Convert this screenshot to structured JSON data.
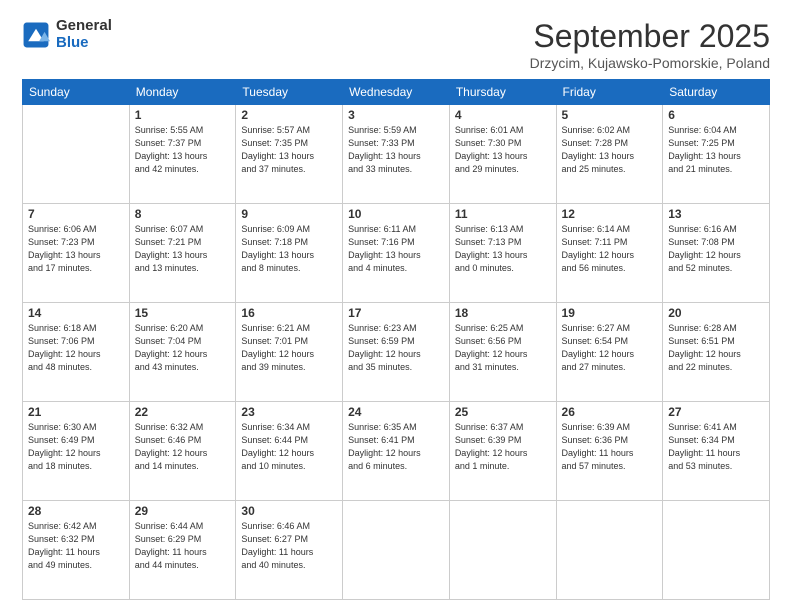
{
  "logo": {
    "general": "General",
    "blue": "Blue"
  },
  "header": {
    "month": "September 2025",
    "location": "Drzycim, Kujawsko-Pomorskie, Poland"
  },
  "weekdays": [
    "Sunday",
    "Monday",
    "Tuesday",
    "Wednesday",
    "Thursday",
    "Friday",
    "Saturday"
  ],
  "weeks": [
    [
      {
        "day": "",
        "info": ""
      },
      {
        "day": "1",
        "info": "Sunrise: 5:55 AM\nSunset: 7:37 PM\nDaylight: 13 hours\nand 42 minutes."
      },
      {
        "day": "2",
        "info": "Sunrise: 5:57 AM\nSunset: 7:35 PM\nDaylight: 13 hours\nand 37 minutes."
      },
      {
        "day": "3",
        "info": "Sunrise: 5:59 AM\nSunset: 7:33 PM\nDaylight: 13 hours\nand 33 minutes."
      },
      {
        "day": "4",
        "info": "Sunrise: 6:01 AM\nSunset: 7:30 PM\nDaylight: 13 hours\nand 29 minutes."
      },
      {
        "day": "5",
        "info": "Sunrise: 6:02 AM\nSunset: 7:28 PM\nDaylight: 13 hours\nand 25 minutes."
      },
      {
        "day": "6",
        "info": "Sunrise: 6:04 AM\nSunset: 7:25 PM\nDaylight: 13 hours\nand 21 minutes."
      }
    ],
    [
      {
        "day": "7",
        "info": "Sunrise: 6:06 AM\nSunset: 7:23 PM\nDaylight: 13 hours\nand 17 minutes."
      },
      {
        "day": "8",
        "info": "Sunrise: 6:07 AM\nSunset: 7:21 PM\nDaylight: 13 hours\nand 13 minutes."
      },
      {
        "day": "9",
        "info": "Sunrise: 6:09 AM\nSunset: 7:18 PM\nDaylight: 13 hours\nand 8 minutes."
      },
      {
        "day": "10",
        "info": "Sunrise: 6:11 AM\nSunset: 7:16 PM\nDaylight: 13 hours\nand 4 minutes."
      },
      {
        "day": "11",
        "info": "Sunrise: 6:13 AM\nSunset: 7:13 PM\nDaylight: 13 hours\nand 0 minutes."
      },
      {
        "day": "12",
        "info": "Sunrise: 6:14 AM\nSunset: 7:11 PM\nDaylight: 12 hours\nand 56 minutes."
      },
      {
        "day": "13",
        "info": "Sunrise: 6:16 AM\nSunset: 7:08 PM\nDaylight: 12 hours\nand 52 minutes."
      }
    ],
    [
      {
        "day": "14",
        "info": "Sunrise: 6:18 AM\nSunset: 7:06 PM\nDaylight: 12 hours\nand 48 minutes."
      },
      {
        "day": "15",
        "info": "Sunrise: 6:20 AM\nSunset: 7:04 PM\nDaylight: 12 hours\nand 43 minutes."
      },
      {
        "day": "16",
        "info": "Sunrise: 6:21 AM\nSunset: 7:01 PM\nDaylight: 12 hours\nand 39 minutes."
      },
      {
        "day": "17",
        "info": "Sunrise: 6:23 AM\nSunset: 6:59 PM\nDaylight: 12 hours\nand 35 minutes."
      },
      {
        "day": "18",
        "info": "Sunrise: 6:25 AM\nSunset: 6:56 PM\nDaylight: 12 hours\nand 31 minutes."
      },
      {
        "day": "19",
        "info": "Sunrise: 6:27 AM\nSunset: 6:54 PM\nDaylight: 12 hours\nand 27 minutes."
      },
      {
        "day": "20",
        "info": "Sunrise: 6:28 AM\nSunset: 6:51 PM\nDaylight: 12 hours\nand 22 minutes."
      }
    ],
    [
      {
        "day": "21",
        "info": "Sunrise: 6:30 AM\nSunset: 6:49 PM\nDaylight: 12 hours\nand 18 minutes."
      },
      {
        "day": "22",
        "info": "Sunrise: 6:32 AM\nSunset: 6:46 PM\nDaylight: 12 hours\nand 14 minutes."
      },
      {
        "day": "23",
        "info": "Sunrise: 6:34 AM\nSunset: 6:44 PM\nDaylight: 12 hours\nand 10 minutes."
      },
      {
        "day": "24",
        "info": "Sunrise: 6:35 AM\nSunset: 6:41 PM\nDaylight: 12 hours\nand 6 minutes."
      },
      {
        "day": "25",
        "info": "Sunrise: 6:37 AM\nSunset: 6:39 PM\nDaylight: 12 hours\nand 1 minute."
      },
      {
        "day": "26",
        "info": "Sunrise: 6:39 AM\nSunset: 6:36 PM\nDaylight: 11 hours\nand 57 minutes."
      },
      {
        "day": "27",
        "info": "Sunrise: 6:41 AM\nSunset: 6:34 PM\nDaylight: 11 hours\nand 53 minutes."
      }
    ],
    [
      {
        "day": "28",
        "info": "Sunrise: 6:42 AM\nSunset: 6:32 PM\nDaylight: 11 hours\nand 49 minutes."
      },
      {
        "day": "29",
        "info": "Sunrise: 6:44 AM\nSunset: 6:29 PM\nDaylight: 11 hours\nand 44 minutes."
      },
      {
        "day": "30",
        "info": "Sunrise: 6:46 AM\nSunset: 6:27 PM\nDaylight: 11 hours\nand 40 minutes."
      },
      {
        "day": "",
        "info": ""
      },
      {
        "day": "",
        "info": ""
      },
      {
        "day": "",
        "info": ""
      },
      {
        "day": "",
        "info": ""
      }
    ]
  ]
}
